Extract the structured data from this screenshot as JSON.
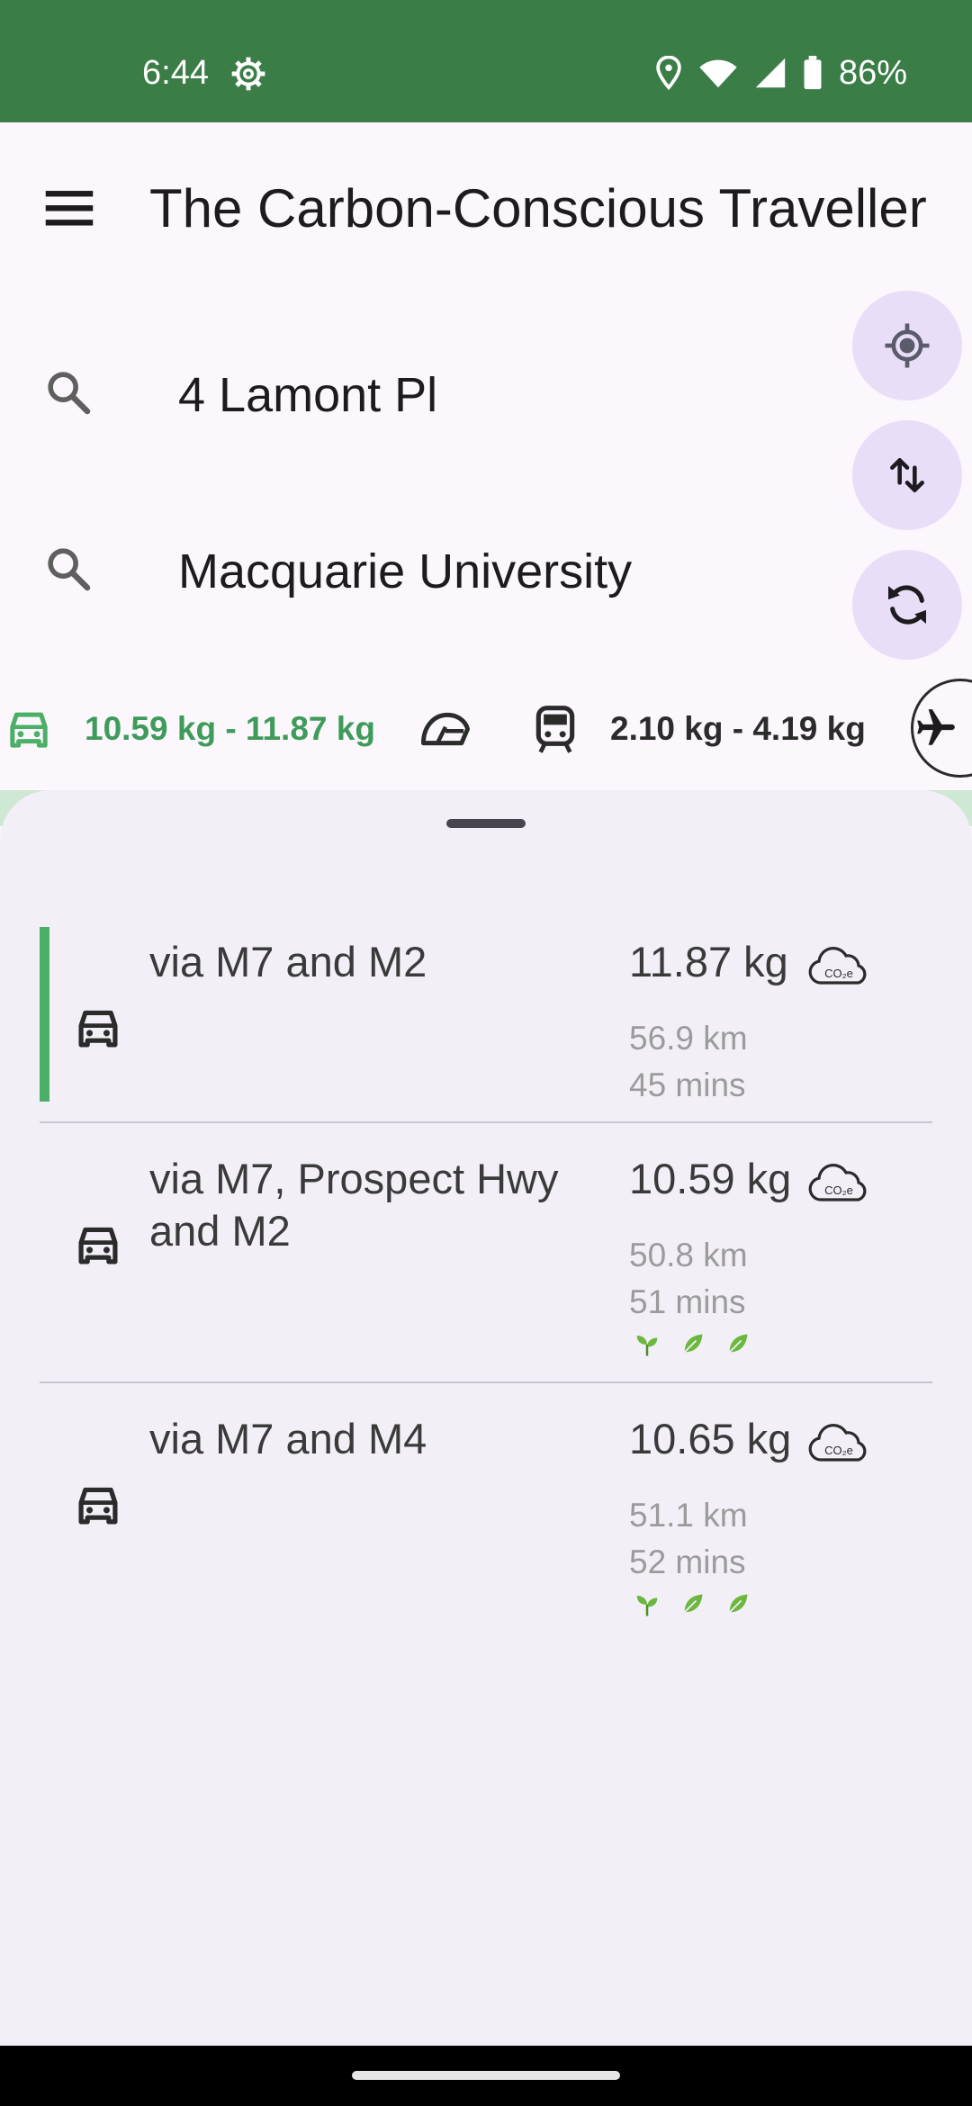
{
  "status_bar": {
    "time": "6:44",
    "battery": "86%",
    "icons": [
      "settings-gear-icon",
      "location-pin-icon",
      "wifi-icon",
      "cell-signal-icon",
      "battery-icon"
    ]
  },
  "app_bar": {
    "title": "The Carbon-Conscious Traveller",
    "menu_icon": "hamburger-menu-icon"
  },
  "search": {
    "from": "4 Lamont Pl",
    "to": "Macquarie University",
    "icon": "search-icon"
  },
  "fabs": [
    "my-location-icon",
    "swap-icon",
    "refresh-icon"
  ],
  "modes": [
    {
      "icon": "car-icon",
      "range": "10.59 kg - 11.87 kg",
      "selected": true
    },
    {
      "icon": "motorbike-icon",
      "range": "",
      "selected": false
    },
    {
      "icon": "train-icon",
      "range": "2.10 kg - 4.19 kg",
      "selected": false
    },
    {
      "icon": "plane-icon",
      "range": "",
      "selected": false
    }
  ],
  "routes": [
    {
      "name": "via M7 and M2",
      "emissions": "11.87 kg",
      "distance": "56.9 km",
      "duration": "45 mins",
      "selected": true,
      "leaves": 0
    },
    {
      "name": "via M7, Prospect Hwy and M2",
      "emissions": "10.59 kg",
      "distance": "50.8 km",
      "duration": "51 mins",
      "selected": false,
      "leaves": 3
    },
    {
      "name": "via M7 and M4",
      "emissions": "10.65 kg",
      "distance": "51.1 km",
      "duration": "52 mins",
      "selected": false,
      "leaves": 3
    }
  ],
  "colors": {
    "status_bar": "#3a7d47",
    "accent_green": "#4caf68",
    "selected_mode_text": "#3f9b5a",
    "fab_bg": "#e8def8",
    "sheet_bg": "#f3eff7"
  }
}
